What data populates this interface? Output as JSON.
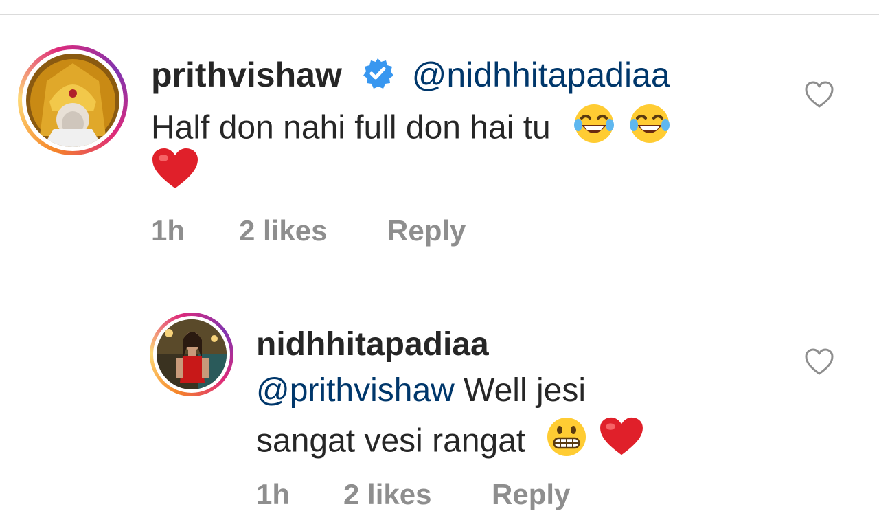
{
  "comments": [
    {
      "username": "prithvishaw",
      "verified": true,
      "mention": "@nidhhitapadiaa",
      "text_line1": "Half don nahi full don hai tu",
      "time": "1h",
      "likes": "2 likes",
      "reply": "Reply"
    },
    {
      "username": "nidhhitapadiaa",
      "verified": false,
      "mention": "@prithvishaw",
      "text_line1_rest": "Well jesi",
      "text_line2": "sangat vesi rangat",
      "time": "1h",
      "likes": "2 likes",
      "reply": "Reply"
    }
  ],
  "colors": {
    "mention": "#00376b",
    "meta": "#8e8e8e",
    "verified": "#3897f0",
    "heart_emoji": "#e0202a"
  },
  "icons": [
    "verified-badge-icon",
    "laughing-emoji-icon",
    "heart-emoji-icon",
    "grinning-emoji-icon",
    "like-heart-icon"
  ]
}
